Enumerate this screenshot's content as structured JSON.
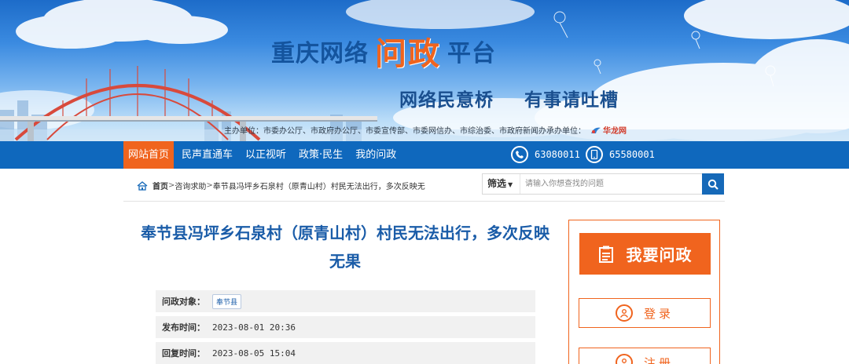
{
  "banner": {
    "title_part1": "重庆网络",
    "title_part2": "问政",
    "title_part3": "平台",
    "slogan_1": "网络民意桥",
    "slogan_2": "有事请吐槽",
    "hosts": "主办单位：市委办公厅、市政府办公厅、市委宣传部、市委网信办、市综治委、市政府新闻办",
    "cohost_label": "承办单位：",
    "cohost_logo": "华龙网"
  },
  "nav": {
    "items": [
      "网站首页",
      "民声直通车",
      "以正视听",
      "政策·民生",
      "我的问政"
    ],
    "phone_1": "63080011",
    "phone_2": "65580001"
  },
  "breadcrumb": {
    "home": "首页",
    "section": "咨询求助",
    "current": "奉节县冯坪乡石泉村（原青山村）村民无法出行，多次反映无"
  },
  "search": {
    "filter_label": "筛选",
    "placeholder": "请输入你想查找的问题"
  },
  "post": {
    "title": "奉节县冯坪乡石泉村（原青山村）村民无法出行，多次反映无果",
    "target_label": "问政对象：",
    "target_value": "奉节县",
    "published_label": "发布时间：",
    "published_value": "2023-08-01 20:36",
    "replied_label": "回复时间：",
    "replied_value": "2023-08-05 15:04"
  },
  "sidebar": {
    "ask_label": "我要问政",
    "login_label": "登录",
    "register_label": "注册"
  },
  "colors": {
    "accent": "#f0641e",
    "nav": "#0f68bd",
    "title": "#1a5ca8"
  }
}
